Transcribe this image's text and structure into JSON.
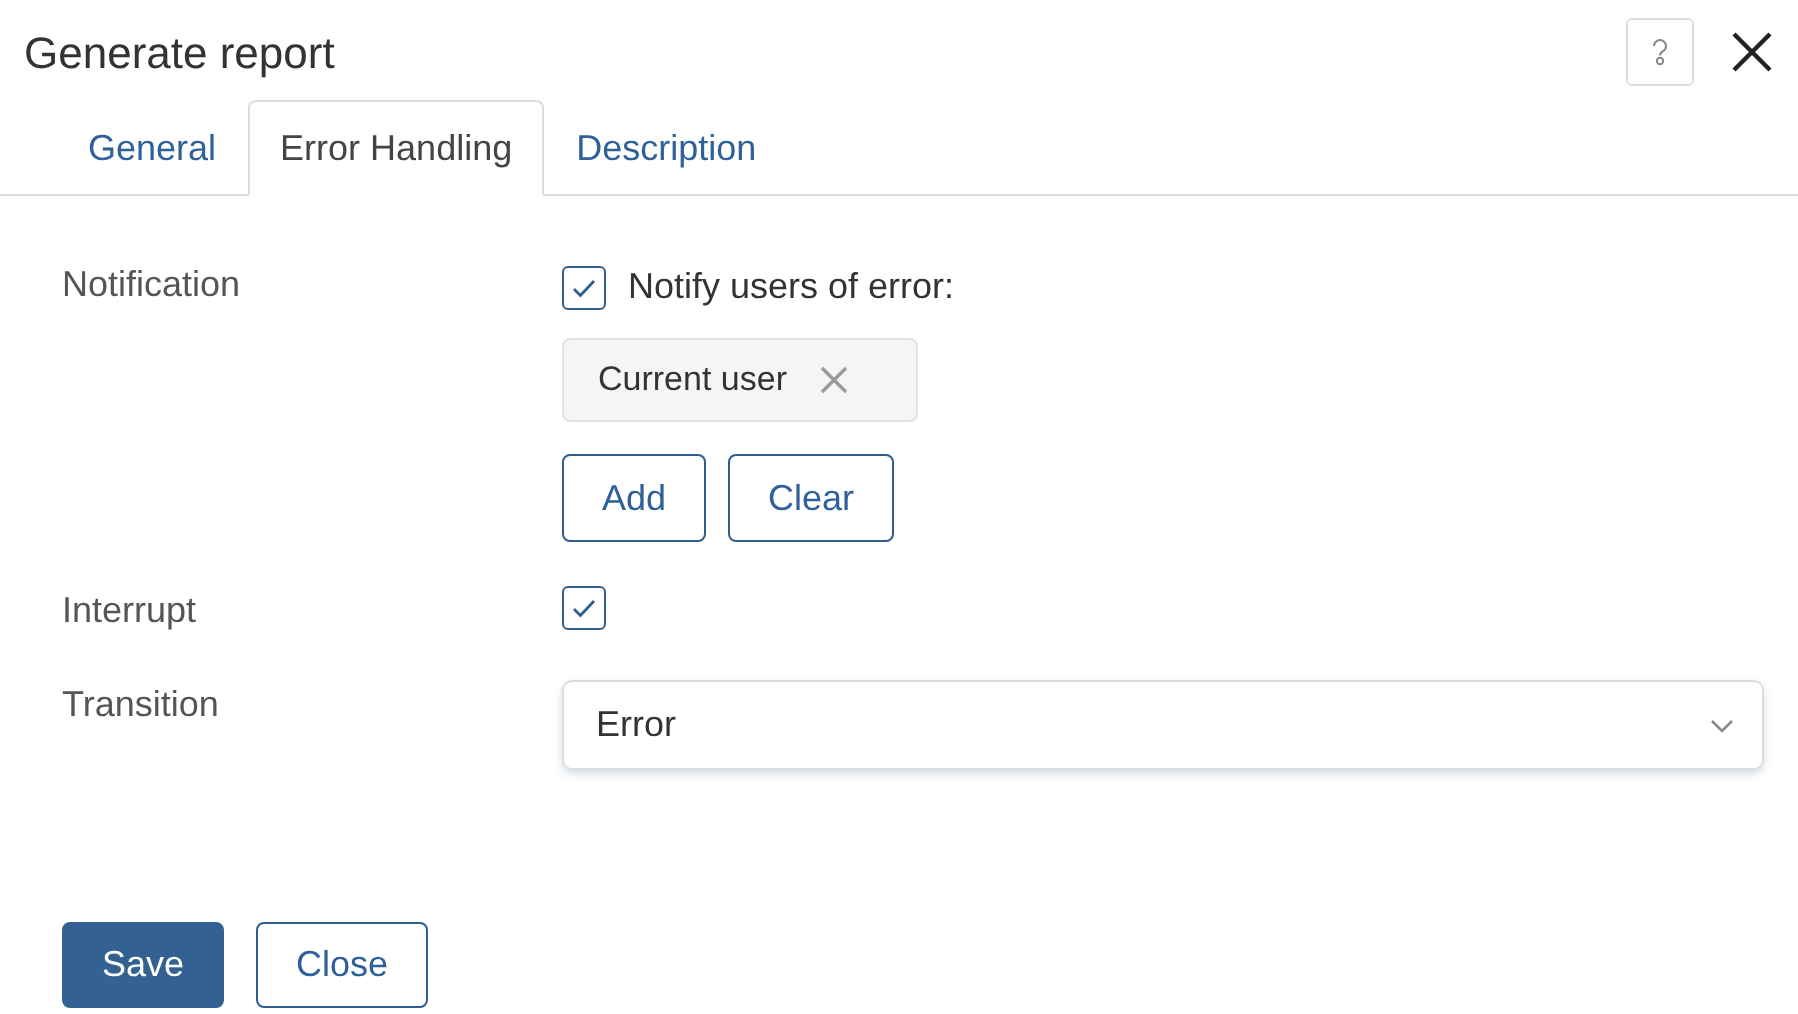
{
  "window": {
    "title": "Generate report"
  },
  "tabs": [
    {
      "label": "General",
      "selected": false
    },
    {
      "label": "Error Handling",
      "selected": true
    },
    {
      "label": "Description",
      "selected": false
    }
  ],
  "notification": {
    "label": "Notification",
    "checked": true,
    "checkbox_label": "Notify users of error:",
    "recipients": [
      "Current user"
    ],
    "buttons": [
      "Add",
      "Clear"
    ]
  },
  "interrupt": {
    "label": "Interrupt",
    "checked": true
  },
  "transition": {
    "label": "Transition",
    "value": "Error"
  },
  "footer_buttons": [
    {
      "label": "Save",
      "kind": "primary"
    },
    {
      "label": "Close",
      "kind": "secondary"
    }
  ]
}
